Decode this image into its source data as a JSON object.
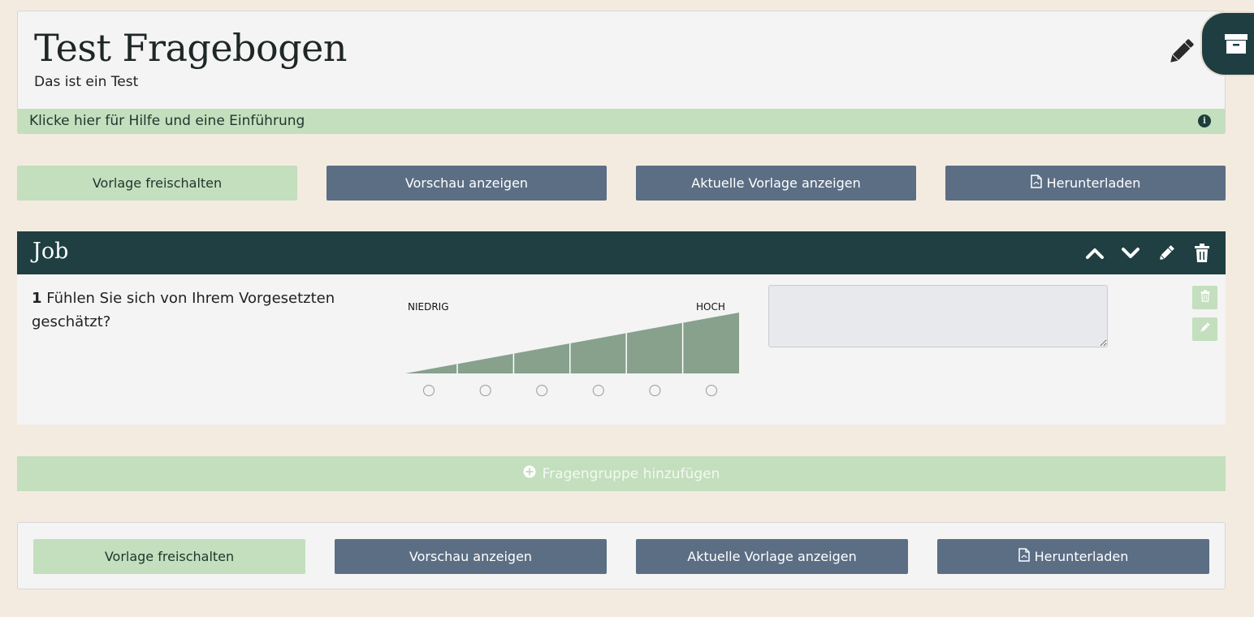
{
  "header": {
    "title": "Test Fragebogen",
    "subtitle": "Das ist ein Test",
    "help_text": "Klicke hier für Hilfe und eine Einführung"
  },
  "actions": {
    "unlock_label": "Vorlage freischalten",
    "preview_label": "Vorschau anzeigen",
    "current_label": "Aktuelle Vorlage anzeigen",
    "download_label": "Herunterladen"
  },
  "group": {
    "title": "Job",
    "question": {
      "number": "1",
      "text": "Fühlen Sie sich von Ihrem Vorgesetzten geschätzt?",
      "scale_low": "NIEDRIG",
      "scale_high": "HOCH",
      "options_count": 6,
      "answer_value": ""
    }
  },
  "add_group_label": "Fragengruppe hinzufügen",
  "colors": {
    "background": "#f4ebe0",
    "accent_green": "#c3dfbd",
    "slate_button": "#5b6e84",
    "dark_header": "#1f3f42",
    "scale_fill": "#87a18c"
  },
  "icons": {
    "edit": "pencil-icon",
    "archive": "archive-icon",
    "info": "info-icon",
    "pdf": "pdf-file-icon",
    "up": "chevron-up-icon",
    "down": "chevron-down-icon",
    "delete": "trash-icon",
    "add": "plus-circle-icon"
  }
}
